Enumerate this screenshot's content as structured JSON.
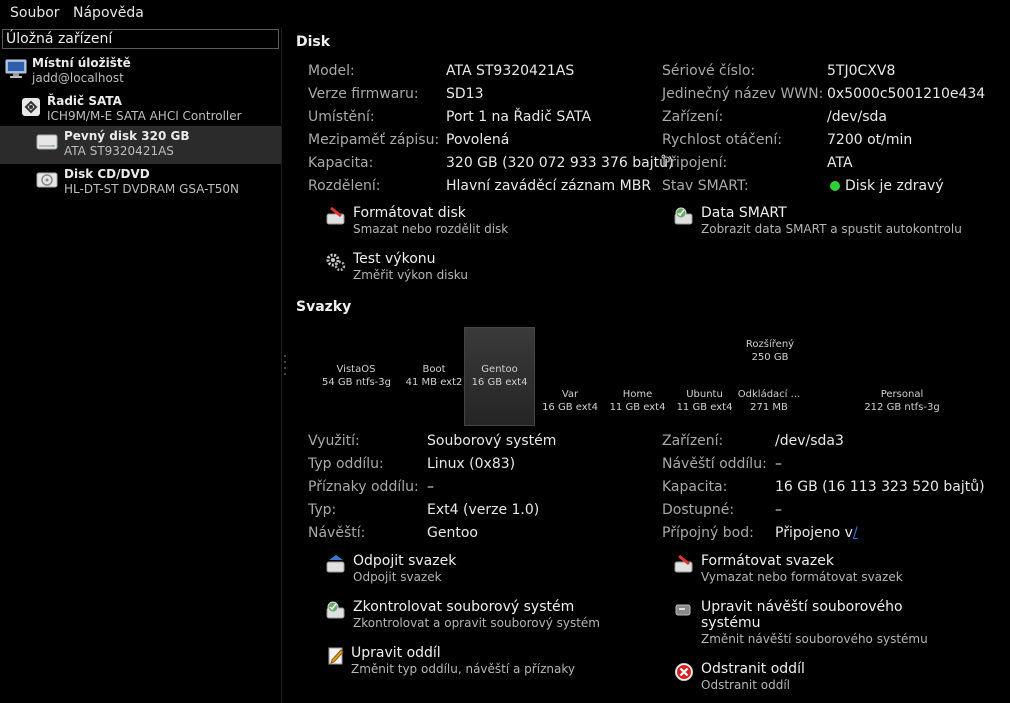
{
  "menu": {
    "file": "Soubor",
    "help": "Nápověda"
  },
  "sidebar": {
    "title": "Úložná zařízení",
    "nodes": [
      {
        "title": "Místní úložiště",
        "subtitle": "jadd@localhost"
      },
      {
        "title": "Řadič SATA",
        "subtitle": "ICH9M/M-E SATA AHCI Controller"
      },
      {
        "title": "Pevný disk 320 GB",
        "subtitle": "ATA ST9320421AS"
      },
      {
        "title": "Disk CD/DVD",
        "subtitle": "HL-DT-ST DVDRAM GSA-T50N"
      }
    ]
  },
  "disk": {
    "title": "Disk",
    "left": [
      {
        "label": "Model:",
        "value": "ATA ST9320421AS"
      },
      {
        "label": "Verze firmwaru:",
        "value": "SD13"
      },
      {
        "label": "Umístění:",
        "value": "Port 1 na Řadič SATA"
      },
      {
        "label": "Mezipaměť zápisu:",
        "value": "Povolená"
      },
      {
        "label": "Kapacita:",
        "value": "320 GB (320 072 933 376 bajtů)"
      },
      {
        "label": "Rozdělení:",
        "value": "Hlavní zaváděcí záznam MBR"
      }
    ],
    "right": [
      {
        "label": "Sériové číslo:",
        "value": "5TJ0CXV8"
      },
      {
        "label": "Jedinečný název WWN:",
        "value": "0x5000c5001210e434"
      },
      {
        "label": "Zařízení:",
        "value": "/dev/sda"
      },
      {
        "label": "Rychlost otáčení:",
        "value": "7200 ot/min"
      },
      {
        "label": "Připojení:",
        "value": "ATA"
      },
      {
        "label": "Stav SMART:",
        "value": "Disk je zdravý"
      }
    ],
    "actions": [
      {
        "title": "Formátovat disk",
        "subtitle": "Smazat nebo rozdělit disk"
      },
      {
        "title": "Data SMART",
        "subtitle": "Zobrazit data SMART a spustit autokontrolu"
      },
      {
        "title": "Test výkonu",
        "subtitle": "Změřit výkon disku"
      }
    ]
  },
  "volumes": {
    "title": "Svazky",
    "top": [
      {
        "name": "VistaOS",
        "info": "54 GB ntfs-3g"
      },
      {
        "name": "Boot",
        "info": "41 MB ext2"
      },
      {
        "name": "Gentoo",
        "info": "16 GB ext4"
      },
      {
        "name": "Rozšířený",
        "info": "250 GB"
      }
    ],
    "extended": [
      {
        "name": "Var",
        "info": "16 GB ext4"
      },
      {
        "name": "Home",
        "info": "11 GB ext4"
      },
      {
        "name": "Ubuntu",
        "info": "11 GB ext4"
      },
      {
        "name": "Odkládací ...",
        "info": "271 MB"
      },
      {
        "name": "Personal",
        "info": "212 GB ntfs-3g"
      }
    ],
    "left": [
      {
        "label": "Využití:",
        "value": "Souborový systém"
      },
      {
        "label": "Typ oddílu:",
        "value": "Linux (0x83)"
      },
      {
        "label": "Příznaky oddílu:",
        "value": "–"
      },
      {
        "label": "Typ:",
        "value": "Ext4 (verze 1.0)"
      },
      {
        "label": "Návěští:",
        "value": "Gentoo"
      }
    ],
    "right": [
      {
        "label": "Zařízení:",
        "value": "/dev/sda3"
      },
      {
        "label": "Návěští oddílu:",
        "value": "–"
      },
      {
        "label": "Kapacita:",
        "value": "16 GB (16 113 323 520 bajtů)"
      },
      {
        "label": "Dostupné:",
        "value": "–"
      },
      {
        "label": "Přípojný bod:",
        "value": "Připojeno v",
        "link": "/"
      }
    ],
    "actions": [
      {
        "title": "Odpojit svazek",
        "subtitle": "Odpojit svazek"
      },
      {
        "title": "Formátovat svazek",
        "subtitle": "Vymazat nebo formátovat svazek"
      },
      {
        "title": "Zkontrolovat souborový systém",
        "subtitle": "Zkontrolovat a opravit souborový systém"
      },
      {
        "title": "Upravit návěští souborového systému",
        "subtitle": "Změnit návěští souborového systému"
      },
      {
        "title": "Upravit oddíl",
        "subtitle": "Změnit typ oddílu, návěští a příznaky"
      },
      {
        "title": "Odstranit oddíl",
        "subtitle": "Odstranit oddíl"
      }
    ]
  },
  "colors": {
    "background": "#000000",
    "selected": "#2b2b2b",
    "healthy": "#2fcf3a",
    "link": "#3a6fe0"
  }
}
